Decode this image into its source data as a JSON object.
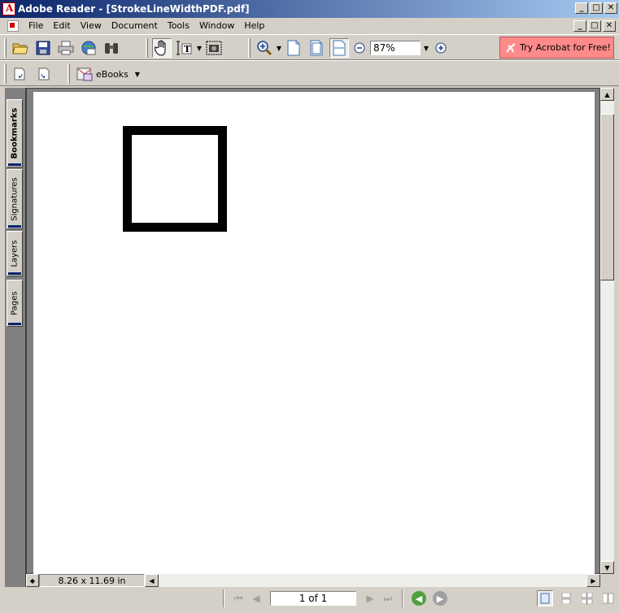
{
  "window": {
    "title": "Adobe Reader - [StrokeLineWidthPDF.pdf]",
    "minimize_label": "_",
    "maximize_label": "□",
    "close_label": "✕"
  },
  "menu": {
    "items": [
      "File",
      "Edit",
      "View",
      "Document",
      "Tools",
      "Window",
      "Help"
    ]
  },
  "toolbar": {
    "zoom_value": "87%",
    "try_acrobat_label": "Try Acrobat for Free!",
    "ebooks_label": "eBooks"
  },
  "side_tabs": [
    "Bookmarks",
    "Signatures",
    "Layers",
    "Pages"
  ],
  "status": {
    "page_size": "8.26 x 11.69 in",
    "page_indicator": "1 of 1"
  },
  "colors": {
    "title_gradient_start": "#0a246a",
    "chrome": "#d4d0c8",
    "try_button": "#ff8a8a"
  }
}
